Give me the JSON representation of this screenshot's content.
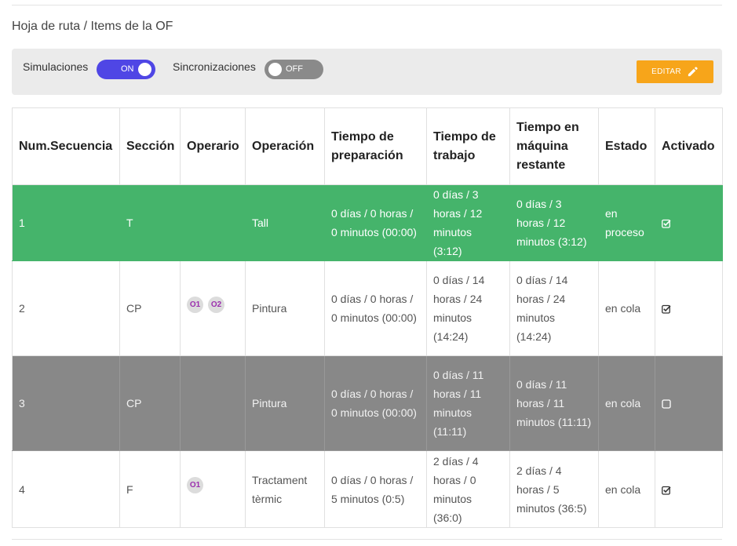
{
  "breadcrumb": "Hoja de ruta / Items de la OF",
  "toolbar": {
    "simulaciones_label": "Simulaciones",
    "simulaciones_state": "ON",
    "sincronizaciones_label": "Sincronizaciones",
    "sincronizaciones_state": "OFF",
    "edit_label": "EDITAR",
    "accent_color": "#4f46e5",
    "edit_color": "#f7a51a"
  },
  "table": {
    "headers": {
      "num_secuencia": "Num.Secuencia",
      "seccion": "Sección",
      "operario": "Operario",
      "operacion": "Operación",
      "tiempo_preparacion": "Tiempo de preparación",
      "tiempo_trabajo": "Tiempo de trabajo",
      "tiempo_restante": "Tiempo en máquina restante",
      "estado": "Estado",
      "activado": "Activado"
    },
    "rows": [
      {
        "num": "1",
        "seccion": "T",
        "operarios": [],
        "operacion": "Tall",
        "preparacion": "0 días / 0 horas / 0 minutos (00:00)",
        "trabajo": "0 días / 3 horas / 12 minutos (3:12)",
        "restante": "0 días / 3 horas / 12 minutos (3:12)",
        "estado": "en proceso",
        "activado": true,
        "row_color": "#45b46b"
      },
      {
        "num": "2",
        "seccion": "CP",
        "operarios": [
          "O1",
          "O2"
        ],
        "operacion": "Pintura",
        "preparacion": "0 días / 0 horas / 0 minutos (00:00)",
        "trabajo": "0 días / 14 horas / 24 minutos (14:24)",
        "restante": "0 días / 14 horas / 24 minutos (14:24)",
        "estado": "en cola",
        "activado": true,
        "row_color": "#ffffff"
      },
      {
        "num": "3",
        "seccion": "CP",
        "operarios": [],
        "operacion": "Pintura",
        "preparacion": "0 días / 0 horas / 0 minutos (00:00)",
        "trabajo": "0 días / 11 horas / 11 minutos (11:11)",
        "restante": "0 días / 11 horas / 11 minutos (11:11)",
        "estado": "en cola",
        "activado": false,
        "row_color": "#888888"
      },
      {
        "num": "4",
        "seccion": "F",
        "operarios": [
          "O1"
        ],
        "operacion": "Tractament tèrmic",
        "preparacion": "0 días / 0 horas / 5 minutos (0:5)",
        "trabajo": "2 días / 4 horas / 0 minutos (36:0)",
        "restante": "2 días / 4 horas / 5 minutos (36:5)",
        "estado": "en cola",
        "activado": true,
        "row_color": "#ffffff"
      }
    ]
  }
}
